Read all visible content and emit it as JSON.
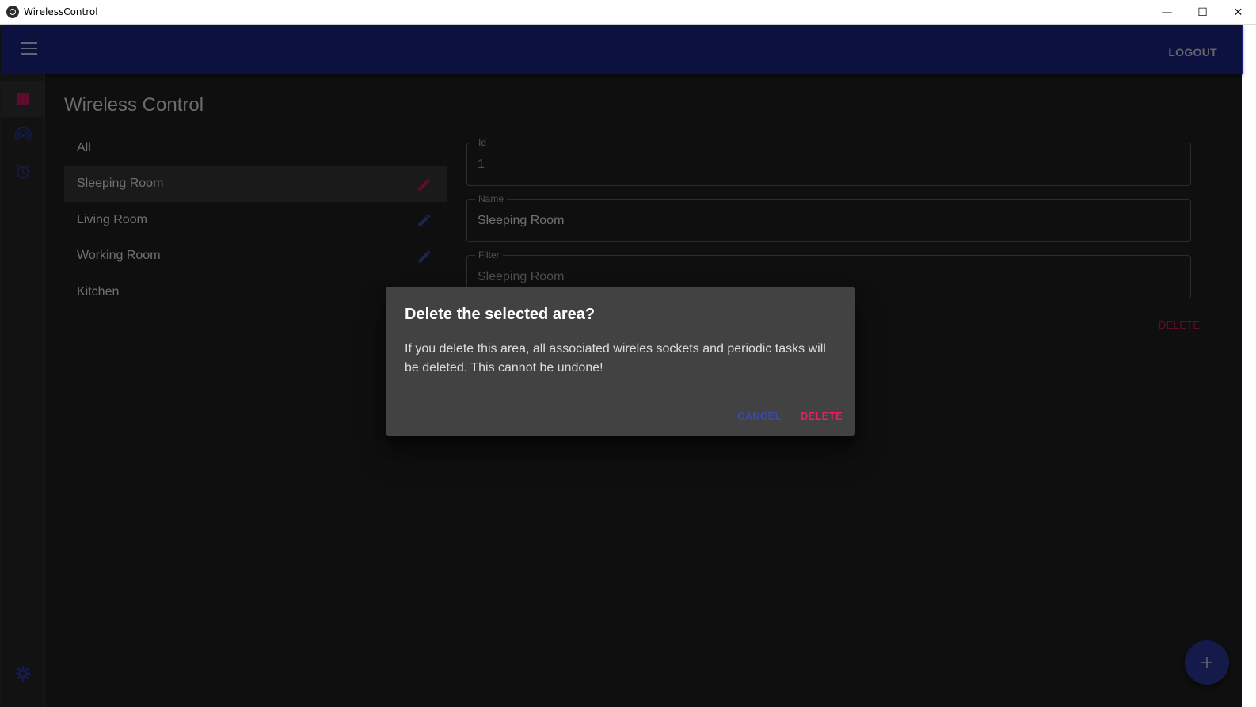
{
  "window": {
    "title": "WirelessControl",
    "minimize": "—",
    "maximize": "☐",
    "close": "✕"
  },
  "appbar": {
    "menu_icon": "hamburger-menu-icon",
    "logout_label": "LOGOUT"
  },
  "leftnav": {
    "items": [
      {
        "icon": "map-icon",
        "active": true
      },
      {
        "icon": "wireless-signal-icon",
        "active": false
      },
      {
        "icon": "alarm-clock-icon",
        "active": false
      }
    ],
    "settings_icon": "gear-icon"
  },
  "page": {
    "title": "Wireless Control"
  },
  "areas": {
    "items": [
      {
        "label": "All",
        "editable": false,
        "selected": false
      },
      {
        "label": "Sleeping Room",
        "editable": true,
        "selected": true
      },
      {
        "label": "Living Room",
        "editable": true,
        "selected": false
      },
      {
        "label": "Working Room",
        "editable": true,
        "selected": false
      },
      {
        "label": "Kitchen",
        "editable": true,
        "selected": false
      }
    ]
  },
  "form": {
    "id_label": "Id",
    "id_value": "1",
    "name_label": "Name",
    "name_value": "Sleeping Room",
    "filter_label": "Filter",
    "filter_value": "Sleeping Room",
    "delete_label": "DELETE"
  },
  "fab": {
    "icon": "plus-icon"
  },
  "dialog": {
    "title": "Delete the selected area?",
    "text": "If you delete this area, all associated wireles sockets and periodic tasks will be deleted. This cannot be undone!",
    "cancel_label": "CANCEL",
    "delete_label": "DELETE"
  },
  "colors": {
    "appbar": "#1a237e",
    "accent_pink": "#e91e63",
    "accent_indigo": "#3949ab",
    "background": "#1e1e1e",
    "dialog": "#424242"
  }
}
